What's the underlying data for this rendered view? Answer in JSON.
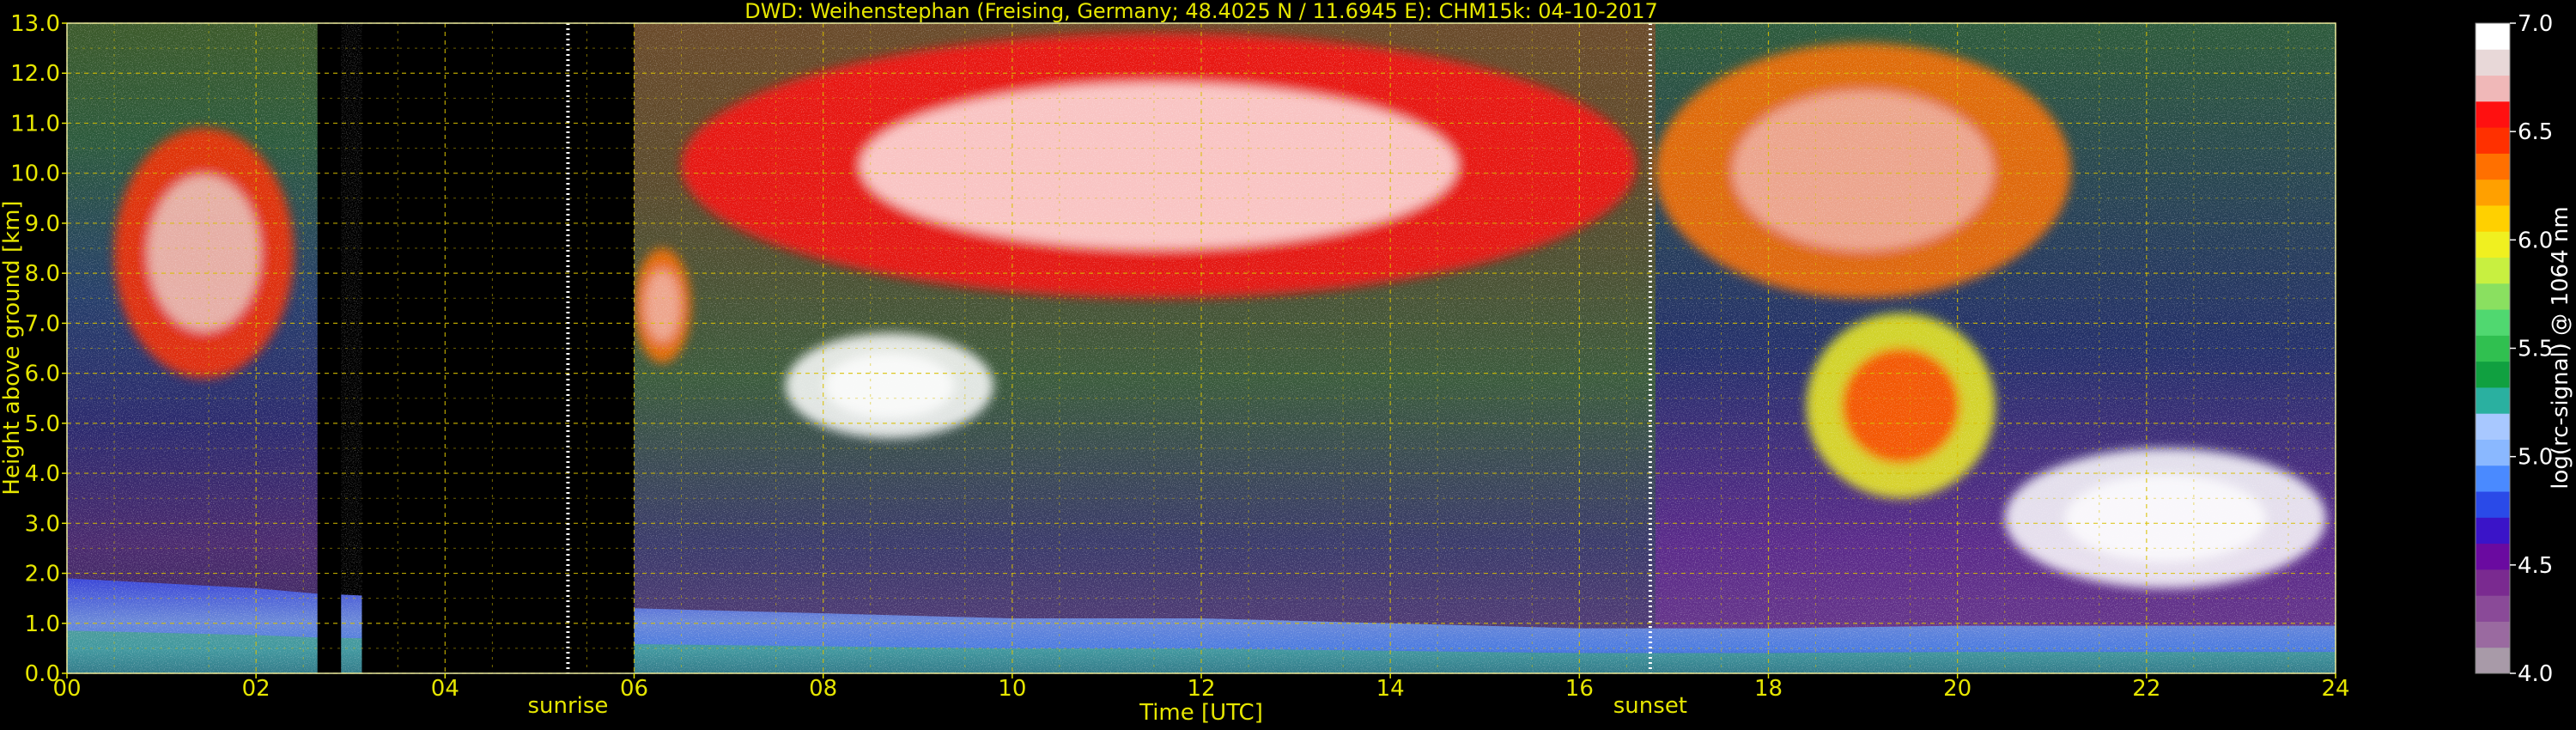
{
  "chart_data": {
    "type": "heatmap",
    "title": "DWD: Weihenstephan (Freising, Germany; 48.4025 N / 11.6945 E):    CHM15k: 04-10-2017",
    "xlabel": "Time [UTC]",
    "ylabel": "Height above ground [km]",
    "xlim": [
      0,
      24
    ],
    "ylim": [
      0,
      13
    ],
    "x_ticks": [
      "00",
      "02",
      "04",
      "06",
      "08",
      "10",
      "12",
      "14",
      "16",
      "18",
      "20",
      "22",
      "24"
    ],
    "y_ticks": [
      "0.0",
      "1.0",
      "2.0",
      "3.0",
      "4.0",
      "5.0",
      "6.0",
      "7.0",
      "8.0",
      "9.0",
      "10.0",
      "11.0",
      "12.0",
      "13.0"
    ],
    "grid": true,
    "colorbar": {
      "label": "log(rc-signal) @ 1064 nm",
      "range": [
        4.0,
        7.0
      ],
      "ticks": [
        "4.0",
        "4.5",
        "5.0",
        "5.5",
        "6.0",
        "6.5",
        "7.0"
      ]
    },
    "markers": [
      {
        "label": "sunrise",
        "x": 5.3
      },
      {
        "label": "sunset",
        "x": 16.75
      }
    ],
    "no_data_intervals": [
      [
        2.65,
        2.9
      ],
      [
        3.12,
        6.0
      ]
    ],
    "cloud_layers": [
      {
        "x": [
          0.5,
          2.4
        ],
        "y": [
          5.9,
          10.9
        ],
        "level": 6.4
      },
      {
        "x": [
          6.0,
          6.6
        ],
        "y": [
          6.2,
          8.5
        ],
        "level": 6.3
      },
      {
        "x": [
          6.5,
          16.6
        ],
        "y": [
          7.5,
          12.8
        ],
        "level": 6.6
      },
      {
        "x": [
          7.6,
          9.8
        ],
        "y": [
          4.7,
          6.8
        ],
        "level": 7.0
      },
      {
        "x": [
          16.8,
          21.2
        ],
        "y": [
          7.5,
          12.6
        ],
        "level": 6.3
      },
      {
        "x": [
          18.4,
          20.4
        ],
        "y": [
          3.5,
          7.2
        ],
        "level": 6.0
      },
      {
        "x": [
          20.5,
          23.9
        ],
        "y": [
          1.7,
          4.5
        ],
        "level": 7.0
      }
    ],
    "boundary_layer": [
      {
        "x": 0,
        "y": 1.9
      },
      {
        "x": 1,
        "y": 1.8
      },
      {
        "x": 2,
        "y": 1.7
      },
      {
        "x": 2.6,
        "y": 1.6
      },
      {
        "x": 6,
        "y": 1.3
      },
      {
        "x": 8,
        "y": 1.2
      },
      {
        "x": 10,
        "y": 1.1
      },
      {
        "x": 12,
        "y": 1.1
      },
      {
        "x": 14,
        "y": 1.0
      },
      {
        "x": 16,
        "y": 0.9
      },
      {
        "x": 18,
        "y": 0.9
      },
      {
        "x": 20,
        "y": 0.95
      },
      {
        "x": 22,
        "y": 0.95
      },
      {
        "x": 24,
        "y": 0.95
      }
    ]
  }
}
